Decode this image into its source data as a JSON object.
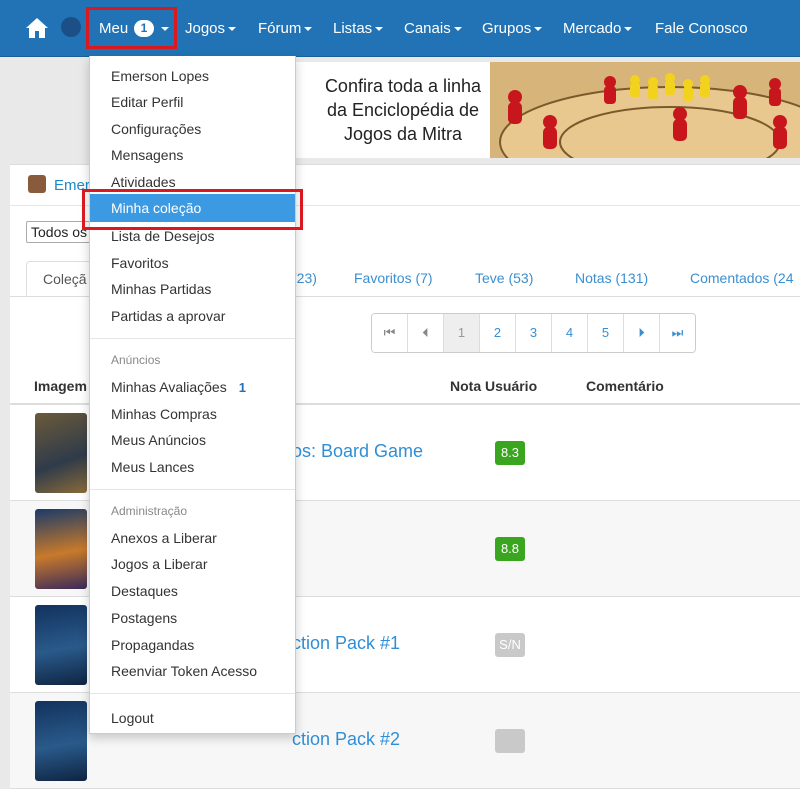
{
  "nav": {
    "meu_label": "Meu",
    "meu_badge": "1",
    "items": [
      "Jogos",
      "Fórum",
      "Listas",
      "Canais",
      "Grupos",
      "Mercado",
      "Fale Conosco"
    ]
  },
  "banner": {
    "line1": "Confira toda a linha",
    "line2": "da Enciclopédia de",
    "line3": "Jogos da Mitra"
  },
  "profile": {
    "name_partial": "Emer"
  },
  "filter": {
    "select_value": "Todos os"
  },
  "tabs": [
    {
      "label": "Coleçã"
    },
    {
      "label": "(23)"
    },
    {
      "label": "Favoritos (7)"
    },
    {
      "label": "Teve (53)"
    },
    {
      "label": "Notas (131)"
    },
    {
      "label": "Comentados (24"
    }
  ],
  "pager": {
    "first": "⏮",
    "prev": "⏴",
    "pages": [
      "1",
      "2",
      "3",
      "4",
      "5"
    ],
    "next": "⏵",
    "last": "⏭"
  },
  "table": {
    "headers": {
      "image": "Imagem",
      "rating": "Nota Usuário",
      "comment": "Comentário"
    },
    "rows": [
      {
        "title": "os: Board Game",
        "score": "8.3",
        "scored": true
      },
      {
        "title": "",
        "score": "8.8",
        "scored": true
      },
      {
        "title": "ction Pack #1",
        "score": "S/N",
        "scored": false
      },
      {
        "title": "ction Pack #2",
        "score": "",
        "scored": false
      }
    ]
  },
  "dropdown": {
    "group1": [
      "Emerson Lopes",
      "Editar Perfil",
      "Configurações",
      "Mensagens",
      "Atividades",
      "Minha coleção",
      "Lista de Desejos",
      "Favoritos",
      "Minhas Partidas",
      "Partidas a aprovar"
    ],
    "header_anuncios": "Anúncios",
    "group2": [
      "Minhas Avaliações",
      "Minhas Compras",
      "Meus Anúncios",
      "Meus Lances"
    ],
    "avaliacoes_badge": "1",
    "header_admin": "Administração",
    "group3": [
      "Anexos a Liberar",
      "Jogos a Liberar",
      "Destaques",
      "Postagens",
      "Propagandas",
      "Reenviar Token Acesso"
    ],
    "logout": "Logout"
  },
  "colors": {
    "nav_bg": "#2173b5",
    "highlight": "#d9191f",
    "active_item": "#3b9ae1",
    "score_green": "#3aa51f"
  }
}
